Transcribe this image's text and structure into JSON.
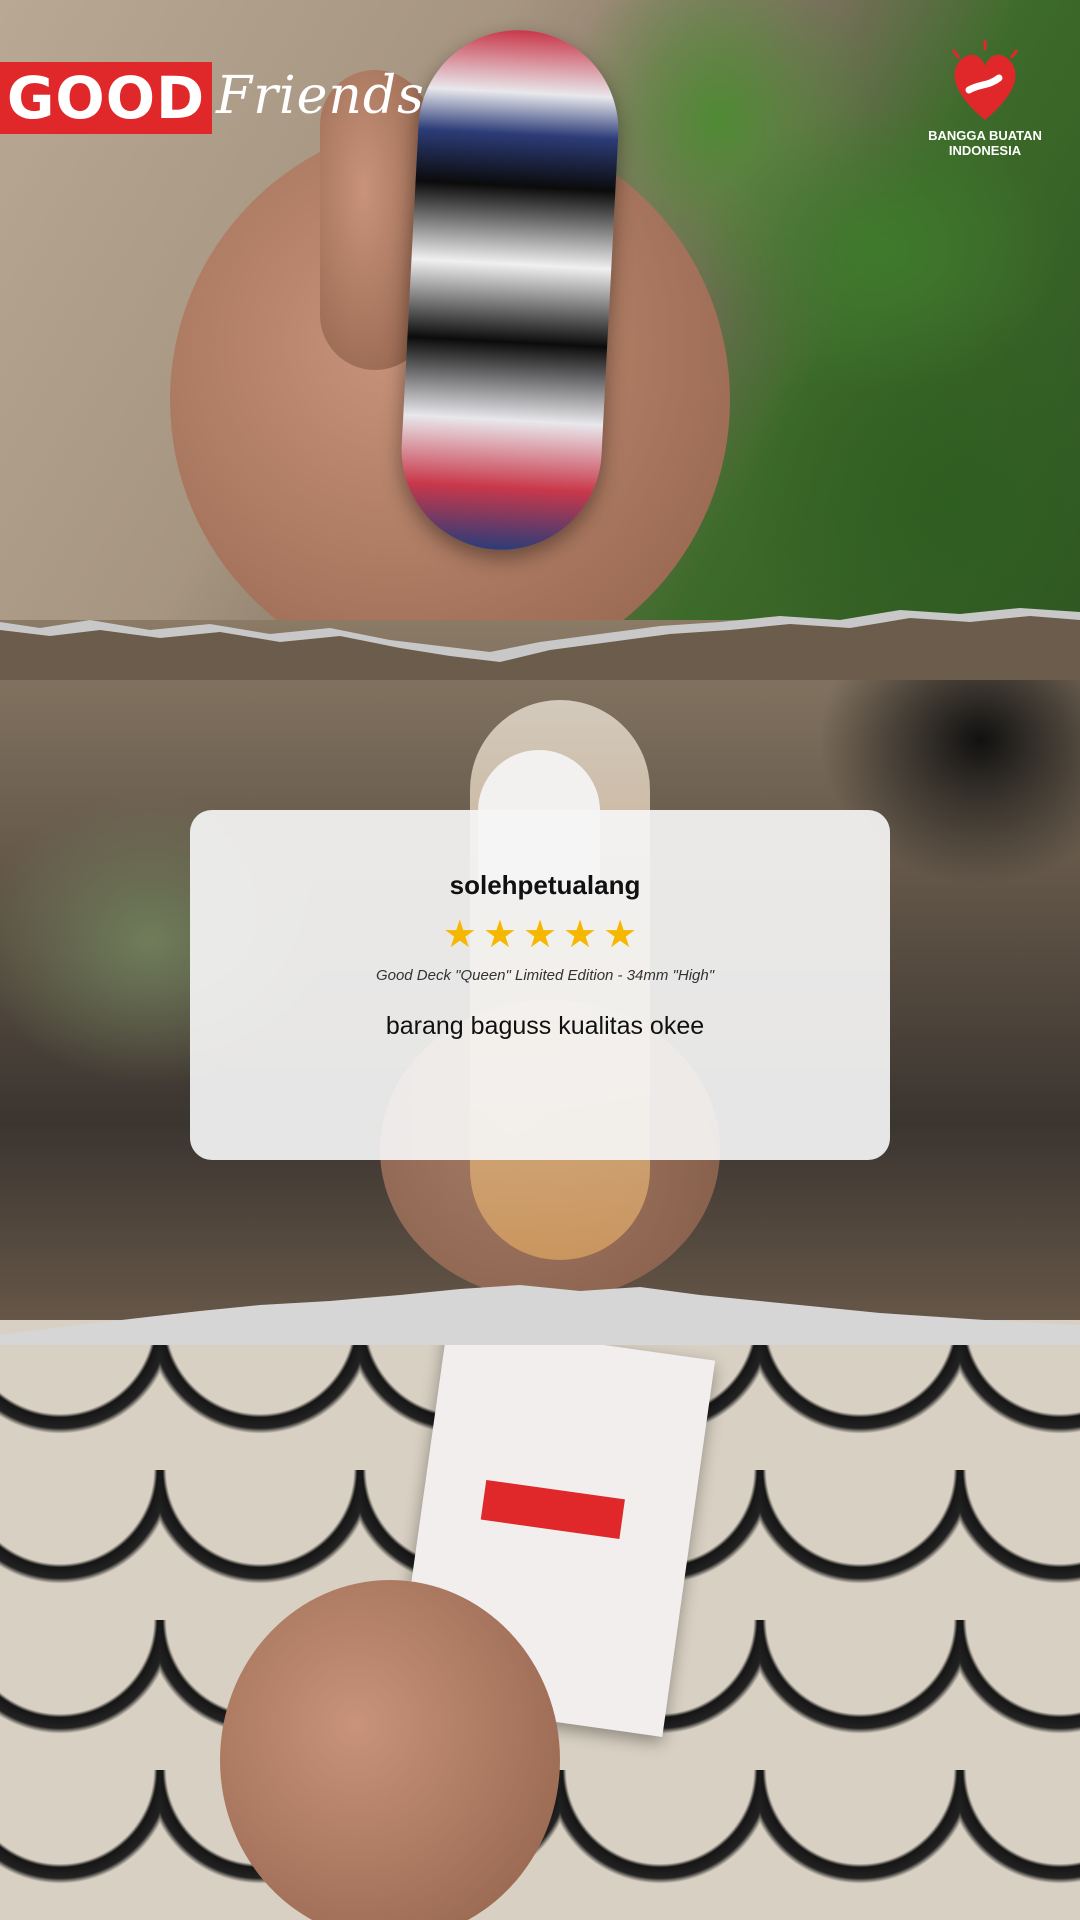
{
  "brand": {
    "logo_word": "GOOD",
    "logo_script": "Friends",
    "badge_text_line1": "BANGGA BUATAN",
    "badge_text_line2": "INDONESIA"
  },
  "review": {
    "username": "solehpetualang",
    "rating": 5,
    "rating_max": 5,
    "stars": [
      "★",
      "★",
      "★",
      "★",
      "★"
    ],
    "product": "Good Deck \"Queen\" Limited Edition - 34mm \"High\"",
    "text": "barang baguss kualitas okee"
  },
  "colors": {
    "brand_red": "#e0282a",
    "star": "#f5b700",
    "card": "#f5f5f5"
  }
}
